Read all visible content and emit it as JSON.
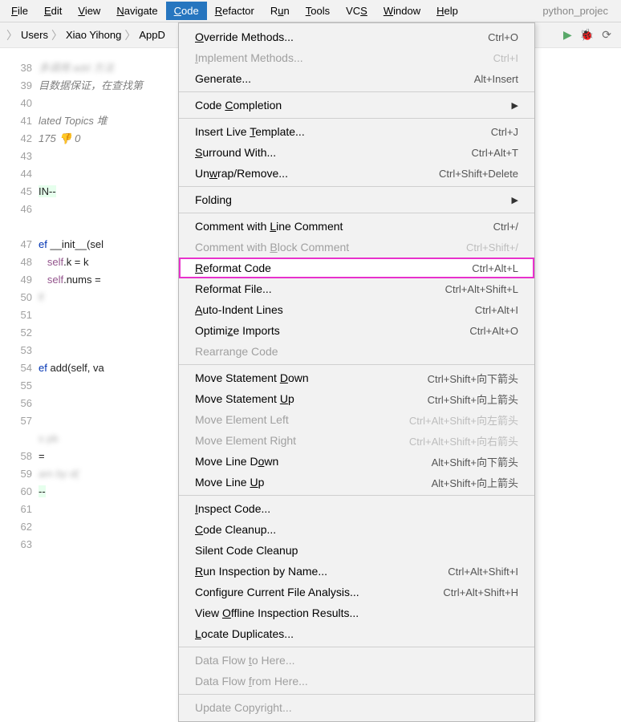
{
  "menubar": {
    "items": [
      {
        "label": "File",
        "u": 0
      },
      {
        "label": "Edit",
        "u": 0
      },
      {
        "label": "View",
        "u": 0
      },
      {
        "label": "Navigate",
        "u": 0
      },
      {
        "label": "Code",
        "u": 0
      },
      {
        "label": "Refactor",
        "u": 0
      },
      {
        "label": "Run",
        "u": 1
      },
      {
        "label": "Tools",
        "u": 0
      },
      {
        "label": "VCS",
        "u": 2
      },
      {
        "label": "Window",
        "u": 0
      },
      {
        "label": "Help",
        "u": 0
      }
    ],
    "active": "Code",
    "project": "python_projec"
  },
  "breadcrumb": [
    "Users",
    "Xiao Yihong",
    "AppD"
  ],
  "gutter": [
    "38",
    "39",
    "40",
    "41",
    "42",
    "43",
    "44",
    "45",
    "46",
    "",
    "47",
    "48",
    "49",
    "50",
    "51",
    "52",
    "53",
    "54",
    "55",
    "56",
    "57",
    "",
    "58",
    "59",
    "60",
    "61",
    "62",
    "63"
  ],
  "code": {
    "c1": "多调用 add 方法",
    "c2": "目数据保证，在查找第",
    "c3": "lated Topics 堆",
    "c4": " 175 👎 0",
    "in": "IN--",
    "def1": "ef ",
    "init": "__init__",
    "def1tail": "(sel",
    "l49a": "self",
    "l49b": ".k = k",
    "l50a": "self",
    "l50b": ".nums =",
    "l51": "         lf",
    "def2": "ef ",
    "add": "add",
    "def2tail": "(self, va",
    "l58": "         s  pb",
    "l59": " =",
    "l60": "am      by  d(",
    "l61": "--"
  },
  "dropdown": [
    {
      "label": "Override Methods...",
      "u": 0,
      "sc": "Ctrl+O"
    },
    {
      "label": "Implement Methods...",
      "u": 0,
      "sc": "Ctrl+I",
      "disabled": true
    },
    {
      "label": "Generate...",
      "sc": "Alt+Insert"
    },
    {
      "sep": true
    },
    {
      "label": "Code Completion",
      "u": 5,
      "arrow": true
    },
    {
      "sep": true
    },
    {
      "label": "Insert Live Template...",
      "u": 12,
      "sc": "Ctrl+J"
    },
    {
      "label": "Surround With...",
      "u": 0,
      "sc": "Ctrl+Alt+T"
    },
    {
      "label": "Unwrap/Remove...",
      "u": 2,
      "sc": "Ctrl+Shift+Delete"
    },
    {
      "sep": true
    },
    {
      "label": "Folding",
      "arrow": true
    },
    {
      "sep": true
    },
    {
      "label": "Comment with Line Comment",
      "u": 13,
      "sc": "Ctrl+/"
    },
    {
      "label": "Comment with Block Comment",
      "u": 13,
      "sc": "Ctrl+Shift+/",
      "disabled": true
    },
    {
      "label": "Reformat Code",
      "u": 0,
      "sc": "Ctrl+Alt+L",
      "highlight": true
    },
    {
      "label": "Reformat File...",
      "sc": "Ctrl+Alt+Shift+L"
    },
    {
      "label": "Auto-Indent Lines",
      "u": 0,
      "sc": "Ctrl+Alt+I"
    },
    {
      "label": "Optimize Imports",
      "u": 6,
      "sc": "Ctrl+Alt+O"
    },
    {
      "label": "Rearrange Code",
      "disabled": true
    },
    {
      "sep": true
    },
    {
      "label": "Move Statement Down",
      "u": 15,
      "sc": "Ctrl+Shift+向下箭头"
    },
    {
      "label": "Move Statement Up",
      "u": 15,
      "sc": "Ctrl+Shift+向上箭头"
    },
    {
      "label": "Move Element Left",
      "sc": "Ctrl+Alt+Shift+向左箭头",
      "disabled": true
    },
    {
      "label": "Move Element Right",
      "sc": "Ctrl+Alt+Shift+向右箭头",
      "disabled": true
    },
    {
      "label": "Move Line Down",
      "u": 11,
      "sc": "Alt+Shift+向下箭头"
    },
    {
      "label": "Move Line Up",
      "u": 10,
      "sc": "Alt+Shift+向上箭头"
    },
    {
      "sep": true
    },
    {
      "label": "Inspect Code...",
      "u": 0
    },
    {
      "label": "Code Cleanup...",
      "u": 0
    },
    {
      "label": "Silent Code Cleanup"
    },
    {
      "label": "Run Inspection by Name...",
      "u": 0,
      "sc": "Ctrl+Alt+Shift+I"
    },
    {
      "label": "Configure Current File Analysis...",
      "sc": "Ctrl+Alt+Shift+H"
    },
    {
      "label": "View Offline Inspection Results...",
      "u": 5
    },
    {
      "label": "Locate Duplicates...",
      "u": 0
    },
    {
      "sep": true
    },
    {
      "label": "Data Flow to Here...",
      "u": 10,
      "disabled": true
    },
    {
      "label": "Data Flow from Here...",
      "u": 10,
      "disabled": true
    },
    {
      "sep": true
    },
    {
      "label": "Update Copyright...",
      "disabled": true
    }
  ]
}
